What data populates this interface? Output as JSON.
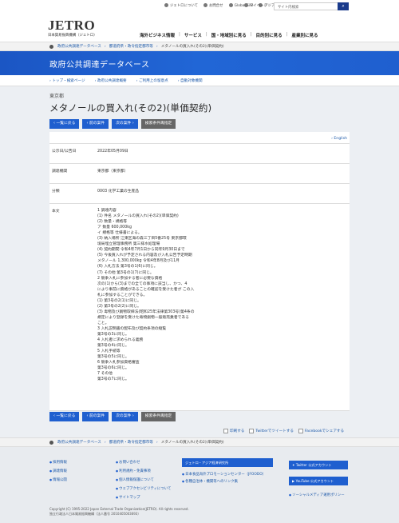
{
  "header": {
    "logo": "JETRO",
    "logo_sub": "日本貿易振興機構（ジェトロ）",
    "utils": [
      "ジェトロについて",
      "お問合せ",
      "Global Site",
      "アジア経済研究所"
    ],
    "mypage": "マイページ",
    "search_placeholder": "サイト内検索",
    "nav": [
      "海外ビジネス情報",
      "サービス",
      "国・地域別に見る",
      "目的別に見る",
      "産業別に見る"
    ]
  },
  "breadcrumb": [
    "政府公共調達データベース",
    "都道府県・政令指定都市等",
    "メタノールの買入れ(その2)(単価契約)"
  ],
  "banner_title": "政府公共調達データベース",
  "subnav": [
    "トップ・検索ページ",
    "政府公共調達概要",
    "ご利用上の留意点",
    "自動対象機関"
  ],
  "page": {
    "org": "東京都",
    "title": "メタノールの買入れ(その2)(単価契約)",
    "buttons": [
      "一覧に戻る",
      "前の案件",
      "次の案件",
      "検索条件再指定"
    ],
    "english": "English"
  },
  "table": {
    "rows": [
      {
        "label": "公示日/公告日",
        "value": "2022年05月09日"
      },
      {
        "label": "調達機関",
        "value": "東京都（東京都）"
      },
      {
        "label": "分類",
        "value": "0003 化学工業の生産品"
      },
      {
        "label": "本文",
        "value": "1 調達内容\n(1) 件名 メタノールの買入れ(その2)(単価契約)\n(2) 数量・規格等\nア 数量 600,000kg\nイ 規格等 仕様書による。\n(3) 納入場所 江東区海の森三丁目5番25号 東京都環\n境局埋立管理事務所 第三排水処理場\n(4) 契約期間 令和4年7月1日から同年9月30日まで\n(5) 今後買入れが予定される内容及び入札公告予定時期\nメタノール 1,300,000kg 令和4年8月及び11月\n(6) 入札方法 第3号の1(6)に同じ。\n(7) その他 第3号の1(7)に同じ。\n2 競争入札に参加する者に必要な資格\n次の(1)から(3)までの全ての事項に該当し、かつ、4\nにより事前に資格があることの確認を受けた者が この入\n札に参加することができる。\n(1) 第3号の2(1)に同じ。\n(2) 第3号の2(2)に同じ。\n(3) 毒物及び劇物取締法(昭和25年法律第303号)第4条の\n規定により登録を受けた毒物劇物一般販売業者である\nこと。\n3 入札説明書の配布及び契約条項の縦覧\n第3号の3に同じ。\n4 入札者に求められる義務\n第3号の4に同じ。\n5 入札手続等\n第3号の5に同じ。\n6 競争入札参加資格審査\n第3号の6に同じ。\n7 その他\n第3号の7に同じ。"
      }
    ]
  },
  "share": [
    "印刷する",
    "Twitterでツイートする",
    "Facebookでシェアする"
  ],
  "footer": {
    "col1": [
      "採用情報",
      "調達情報",
      "情報公開"
    ],
    "col2": [
      "お問い合わせ",
      "利用規約・免責事項",
      "個人情報保護について",
      "ウェブアクセシビリティについて",
      "サイトマップ"
    ],
    "col3_btn": "ジェトロ・アジア経済研究所",
    "col3": [
      "日本食品海外プロモーションセンター（JFOODO）",
      "各種自治体・機関等へのリンク集"
    ],
    "twitter": "Twitter 公式アカウント",
    "youtube": "YouTube 公式アカウント",
    "social": "ソーシャルメディア運用ポリシー",
    "copy1": "Copyright (C) 1995-2022 Japan External Trade Organization(JETRO). All rights reserved.",
    "copy2": "独立行政法人日本貿易振興機構（法人番号 2010405003693）"
  }
}
